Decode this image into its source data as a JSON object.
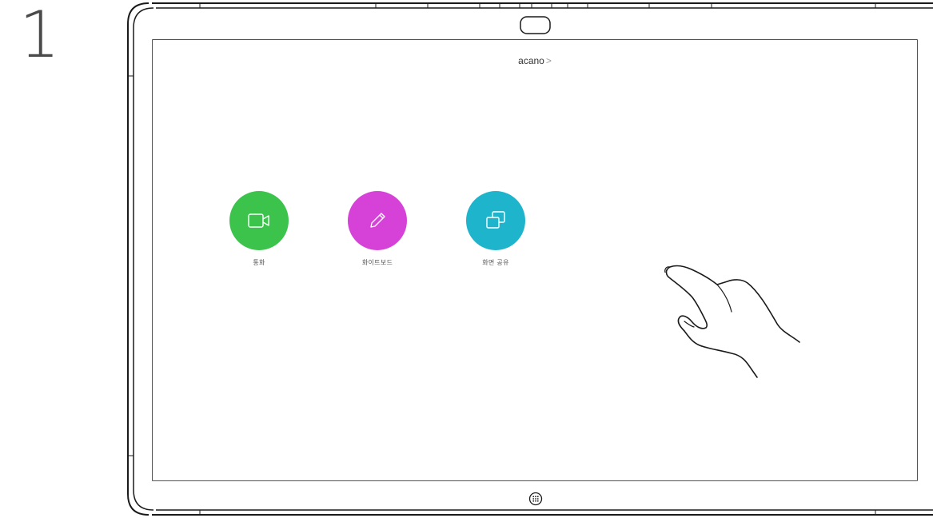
{
  "step": {
    "number": "1"
  },
  "header": {
    "title": "acano",
    "chevron": ">"
  },
  "tiles": [
    {
      "label": "통화",
      "icon": "video-camera-icon",
      "color": "#3bc34b"
    },
    {
      "label": "화이트보드",
      "icon": "pencil-icon",
      "color": "#d642d8"
    },
    {
      "label": "화면 공유",
      "icon": "share-screen-icon",
      "color": "#1db4cc"
    }
  ],
  "device": {
    "home_button_icon": "keypad-icon"
  }
}
